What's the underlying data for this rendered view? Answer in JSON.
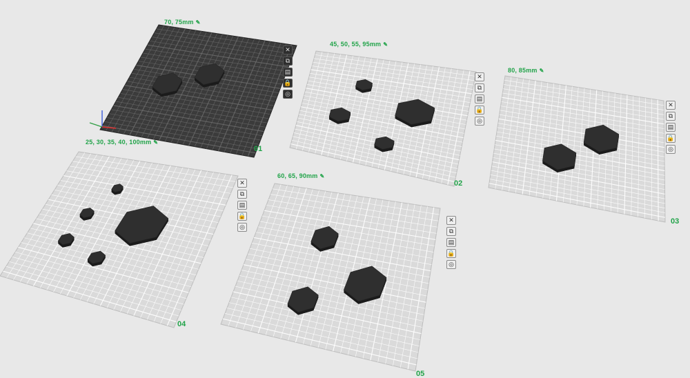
{
  "plates": [
    {
      "id": "plate-01",
      "number": "01",
      "sizes": "70, 75mm",
      "selected": true,
      "hexes": [
        {
          "rel": [
            0.5,
            0.36
          ],
          "size": 0.2
        },
        {
          "rel": [
            0.26,
            0.5
          ],
          "size": 0.2
        }
      ]
    },
    {
      "id": "plate-02",
      "number": "02",
      "sizes": "45, 50, 55, 95mm",
      "selected": false,
      "hexes": [
        {
          "rel": [
            0.34,
            0.26
          ],
          "size": 0.11
        },
        {
          "rel": [
            0.68,
            0.43
          ],
          "size": 0.26
        },
        {
          "rel": [
            0.24,
            0.58
          ],
          "size": 0.14
        },
        {
          "rel": [
            0.54,
            0.76
          ],
          "size": 0.13
        }
      ]
    },
    {
      "id": "plate-03",
      "number": "03",
      "sizes": "80, 85mm",
      "selected": false,
      "hexes": [
        {
          "rel": [
            0.62,
            0.4
          ],
          "size": 0.24
        },
        {
          "rel": [
            0.38,
            0.62
          ],
          "size": 0.23
        }
      ]
    },
    {
      "id": "plate-04",
      "number": "04",
      "sizes": "25, 30, 35, 40, 100mm",
      "selected": false,
      "hexes": [
        {
          "rel": [
            0.34,
            0.21
          ],
          "size": 0.065
        },
        {
          "rel": [
            0.58,
            0.42
          ],
          "size": 0.3
        },
        {
          "rel": [
            0.25,
            0.42
          ],
          "size": 0.08
        },
        {
          "rel": [
            0.22,
            0.63
          ],
          "size": 0.09
        },
        {
          "rel": [
            0.43,
            0.7
          ],
          "size": 0.1
        }
      ]
    },
    {
      "id": "plate-05",
      "number": "05",
      "sizes": "60, 65, 90mm",
      "selected": false,
      "hexes": [
        {
          "rel": [
            0.38,
            0.3
          ],
          "size": 0.16
        },
        {
          "rel": [
            0.66,
            0.54
          ],
          "size": 0.25
        },
        {
          "rel": [
            0.36,
            0.72
          ],
          "size": 0.18
        }
      ]
    }
  ],
  "plate_tools": [
    {
      "name": "remove-plate-icon",
      "glyph": "✕"
    },
    {
      "name": "arrange-icon",
      "glyph": "⧉"
    },
    {
      "name": "plate-settings-icon",
      "glyph": "▤"
    },
    {
      "name": "lock-icon",
      "glyph": "🔒"
    },
    {
      "name": "slice-icon",
      "glyph": "◎"
    }
  ],
  "colors": {
    "background": "#e8e8e8",
    "plate_light": "#dadada",
    "plate_dark": "#3b3b3b",
    "grid_light": "#ffffff",
    "grid_dark": "#6f6f6f",
    "hex_fill": "#2f2f2f",
    "hex_side": "#1b1b1b",
    "accent": "#21a349"
  }
}
